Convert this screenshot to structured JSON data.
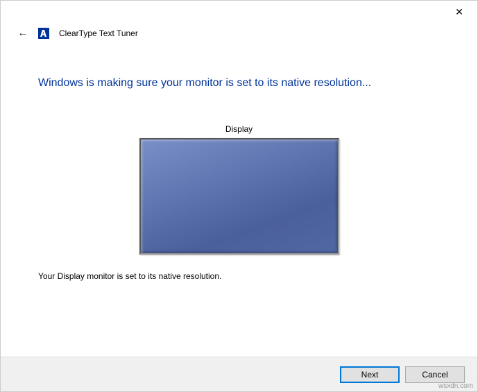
{
  "window": {
    "title": "ClearType Text Tuner"
  },
  "main": {
    "heading": "Windows is making sure your monitor is set to its native resolution...",
    "display_label": "Display",
    "status": "Your Display monitor is set to its native resolution."
  },
  "footer": {
    "next": "Next",
    "cancel": "Cancel"
  },
  "watermark": "wsxdn.com"
}
